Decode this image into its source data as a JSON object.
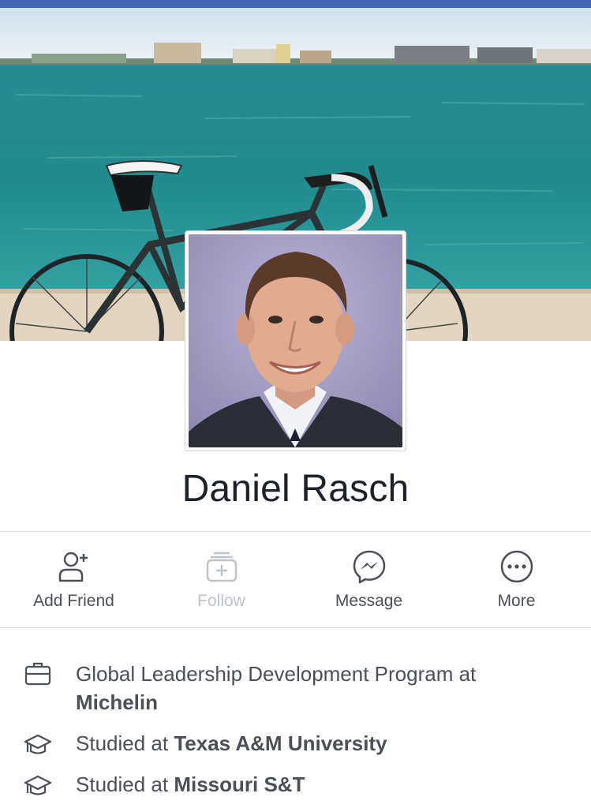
{
  "profile": {
    "name": "Daniel Rasch"
  },
  "actions": [
    {
      "label": "Add Friend",
      "icon": "add-friend-icon",
      "enabled": true
    },
    {
      "label": "Follow",
      "icon": "follow-icon",
      "enabled": false
    },
    {
      "label": "Message",
      "icon": "messenger-icon",
      "enabled": true
    },
    {
      "label": "More",
      "icon": "more-icon",
      "enabled": true
    }
  ],
  "intro": [
    {
      "icon": "briefcase-icon",
      "prefix": "Global Leadership Development Program at",
      "bold": "Michelin"
    },
    {
      "icon": "graduation-cap-icon",
      "prefix": "Studied at",
      "bold": "Texas A&M University"
    },
    {
      "icon": "graduation-cap-icon",
      "prefix": "Studied at",
      "bold": "Missouri S&T"
    }
  ],
  "colors": {
    "brand": "#4267b2",
    "text": "#1d2129",
    "secondary_text": "#4b4f56",
    "disabled_text": "#bec3c9"
  }
}
